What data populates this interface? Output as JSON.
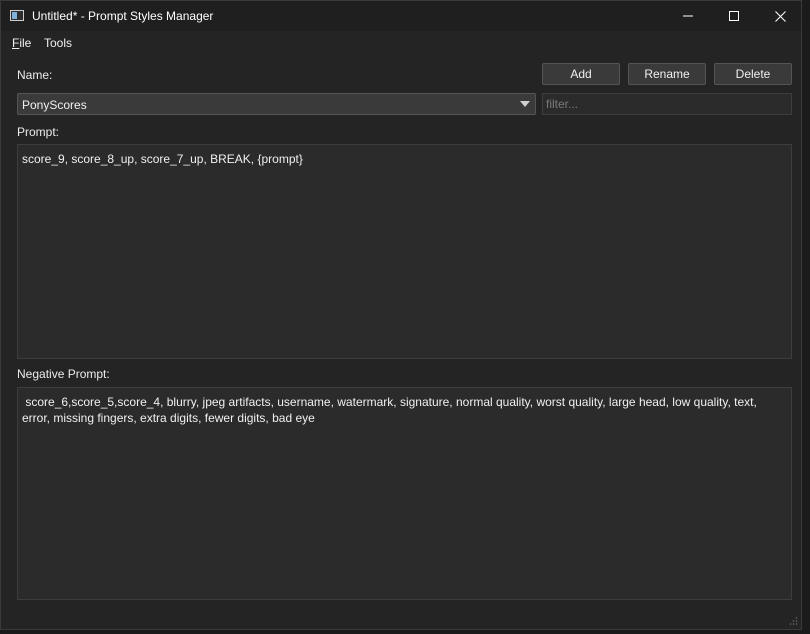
{
  "window": {
    "title": "Untitled* - Prompt Styles Manager"
  },
  "menu": {
    "file_mnemonic": "F",
    "file_rest": "ile",
    "tools": "Tools"
  },
  "labels": {
    "name": "Name:",
    "prompt": "Prompt:",
    "negative_prompt": "Negative Prompt:"
  },
  "buttons": {
    "add": "Add",
    "rename": "Rename",
    "delete": "Delete"
  },
  "style_select": {
    "selected": "PonyScores"
  },
  "filter": {
    "value": "",
    "placeholder": "filter..."
  },
  "prompt_text": "score_9, score_8_up, score_7_up, BREAK, {prompt}",
  "negative_prompt_text": " score_6,score_5,score_4, blurry, jpeg artifacts, username, watermark, signature, normal quality, worst quality, large head, low quality, text, error, missing fingers, extra digits, fewer digits, bad eye",
  "icons": {
    "app": "window-icon",
    "minimize": "minimize-icon",
    "maximize": "maximize-icon",
    "close": "close-icon",
    "dropdown": "chevron-down-icon",
    "resize": "resize-grip-icon"
  },
  "colors": {
    "window_bg": "#242424",
    "titlebar_bg": "#1f1f1f",
    "field_bg": "#2b2b2b",
    "button_bg": "#3a3a3a",
    "text": "#f0f0f0"
  }
}
